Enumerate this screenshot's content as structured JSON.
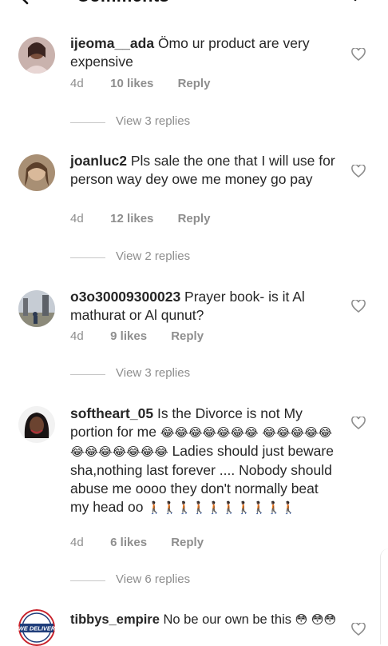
{
  "header": {
    "title": "Comments"
  },
  "comments": [
    {
      "username": "ijeoma__ada",
      "text": "Ömo ur product are very expensive",
      "age": "4d",
      "likes": "10 likes",
      "reply": "Reply",
      "replies": "View 3 replies"
    },
    {
      "username": "joanluc2",
      "text": "Pls sale the one that I will use for person way dey owe me money go pay",
      "age": "4d",
      "likes": "12 likes",
      "reply": "Reply",
      "replies": "View 2 replies"
    },
    {
      "username": "o3o30009300023",
      "text": "Prayer book- is it Al mathurat or Al qunut?",
      "age": "4d",
      "likes": "9 likes",
      "reply": "Reply",
      "replies": "View 3 replies"
    },
    {
      "username": "softheart_05",
      "text_a": "Is the Divorce is not My portion for me",
      "emoji_a": "😂😂😂😂😂😂😂",
      "emoji_b": "😂😂😂😂😂😂😂😂😂😂😂😂",
      "text_b": "Ladies should just beware sha,nothing last forever .... Nobody should abuse me oooo they don't normally beat my head oo",
      "emoji_c": "🚶🏿🚶🏿🚶🏿🚶🏿🚶🏿🚶🏿🚶🏿🚶🏿🚶🏿🚶🏿",
      "age": "4d",
      "likes": "6 likes",
      "reply": "Reply",
      "replies": "View 6 replies"
    },
    {
      "username": "tibbys_empire",
      "text": "No be our own be this",
      "emoji_a": "😳",
      "emoji_b": "😳😳",
      "avatar_text": "WE DELIVER"
    }
  ],
  "colors": {
    "text": "#262626",
    "secondary": "#8e8e8e"
  }
}
